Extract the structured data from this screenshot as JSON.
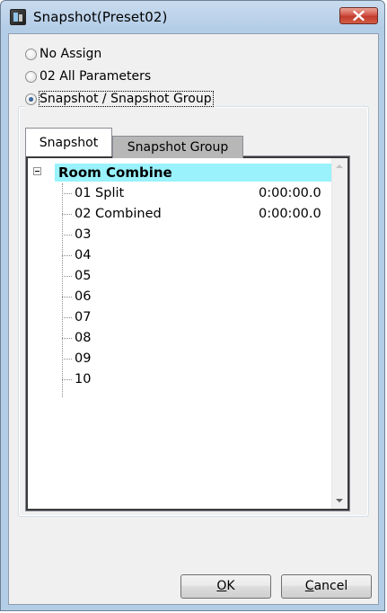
{
  "window": {
    "title": "Snapshot(Preset02)"
  },
  "options": [
    {
      "label": "No Assign",
      "selected": false
    },
    {
      "label": "02 All Parameters",
      "selected": false
    },
    {
      "label": "Snapshot / Snapshot Group",
      "selected": true
    }
  ],
  "tabs": [
    {
      "label": "Snapshot",
      "active": true
    },
    {
      "label": "Snapshot Group",
      "active": false
    }
  ],
  "tree": {
    "root_label": "Room Combine",
    "root_highlight_color": "#99f2fc",
    "items": [
      {
        "label": "01 Split",
        "time": "0:00:00.0"
      },
      {
        "label": "02 Combined",
        "time": "0:00:00.0"
      },
      {
        "label": "03",
        "time": ""
      },
      {
        "label": "04",
        "time": ""
      },
      {
        "label": "05",
        "time": ""
      },
      {
        "label": "06",
        "time": ""
      },
      {
        "label": "07",
        "time": ""
      },
      {
        "label": "08",
        "time": ""
      },
      {
        "label": "09",
        "time": ""
      },
      {
        "label": "10",
        "time": ""
      }
    ]
  },
  "buttons": {
    "ok_mnemonic": "O",
    "ok_rest": "K",
    "cancel_mnemonic": "C",
    "cancel_rest": "ancel"
  },
  "icons": {
    "app": "app-icon",
    "close": "close-icon",
    "expander": "collapse-icon",
    "scroll_up": "scroll-up-arrow-icon",
    "scroll_down": "scroll-down-arrow-icon"
  }
}
